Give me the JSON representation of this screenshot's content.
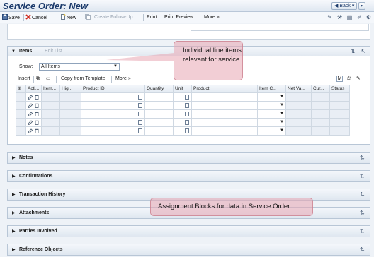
{
  "window": {
    "title": "Service Order: New",
    "back_label": "Back",
    "forward_label": "▸"
  },
  "toolbar": {
    "save": "Save",
    "cancel": "Cancel",
    "new": "New",
    "follow_up": "Create Follow-Up",
    "print": "Print",
    "print_preview": "Print Preview",
    "more": "More »"
  },
  "items": {
    "title": "Items",
    "edit_list": "Edit List",
    "show_label": "Show:",
    "show_value": "All Items",
    "table_toolbar": {
      "insert": "Insert",
      "copy_from_template": "Copy from Template",
      "more": "More »"
    },
    "columns": [
      "Acti...",
      "Item...",
      "Hig...",
      "Product ID",
      "Quantity",
      "Unit",
      "Product",
      "Item C...",
      "Net Va...",
      "Cur...",
      "Status"
    ],
    "rows": [
      [
        "",
        "",
        "",
        "",
        "",
        "",
        "",
        "",
        "",
        "",
        ""
      ],
      [
        "",
        "",
        "",
        "",
        "",
        "",
        "",
        "",
        "",
        "",
        ""
      ],
      [
        "",
        "",
        "",
        "",
        "",
        "",
        "",
        "",
        "",
        "",
        ""
      ],
      [
        "",
        "",
        "",
        "",
        "",
        "",
        "",
        "",
        "",
        "",
        ""
      ],
      [
        "",
        "",
        "",
        "",
        "",
        "",
        "",
        "",
        "",
        "",
        ""
      ]
    ]
  },
  "assignment_blocks": [
    {
      "label": "Notes"
    },
    {
      "label": "Confirmations"
    },
    {
      "label": "Transaction History"
    },
    {
      "label": "Attachments"
    },
    {
      "label": "Parties Involved"
    },
    {
      "label": "Reference Objects"
    }
  ],
  "callouts": {
    "items": "Individual line items relevant for service",
    "blocks": "Assignment Blocks for data in Service Order"
  },
  "colors": {
    "title": "#1b3a6b",
    "callout": "#e8a6b2",
    "panel_header": "#e2e9f1"
  }
}
